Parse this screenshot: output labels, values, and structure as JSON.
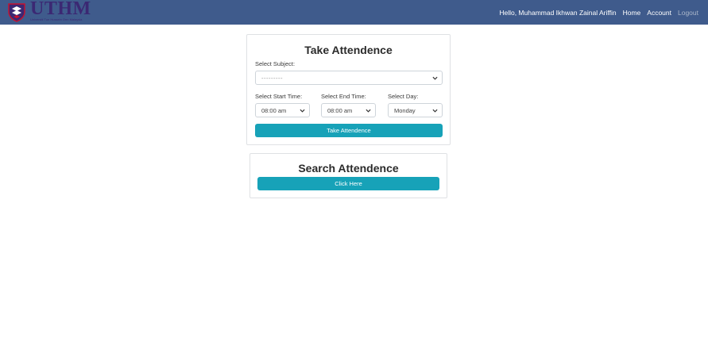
{
  "navbar": {
    "brand": {
      "name": "UTHM",
      "tagline": "Universiti Tun Hussein Onn Malaysia"
    },
    "greeting": "Hello, Muhammad Ikhwan Zainal Ariffin",
    "links": {
      "home": "Home",
      "account": "Account",
      "logout": "Logout"
    }
  },
  "take_attendance": {
    "title": "Take Attendence",
    "subject_label": "Select Subject:",
    "subject_value": "---------",
    "start_label": "Select Start Time:",
    "start_value": "08:00 am",
    "end_label": "Select End Time:",
    "end_value": "08:00 am",
    "day_label": "Select Day:",
    "day_value": "Monday",
    "button": "Take Attendence"
  },
  "search_attendance": {
    "title": "Search Attendence",
    "button": "Click Here"
  },
  "colors": {
    "navbar": "#3f5b8c",
    "button": "#17a2b8",
    "logo": "#3b2873"
  }
}
